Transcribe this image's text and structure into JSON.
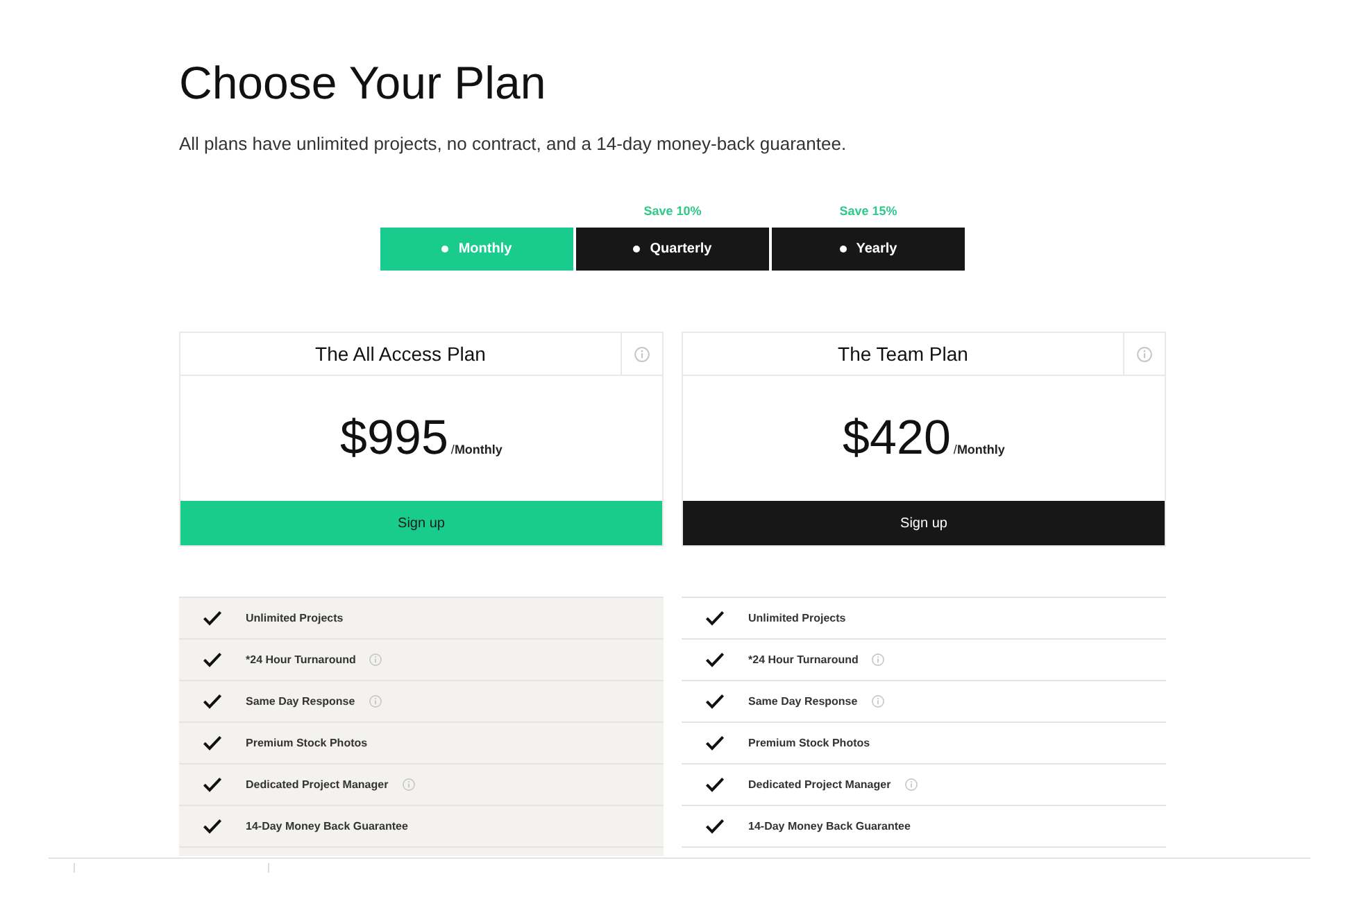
{
  "header": {
    "title": "Choose Your Plan",
    "subtitle": "All plans have unlimited projects, no contract, and a 14-day money-back guarantee."
  },
  "billing_tabs": [
    {
      "label": "Monthly",
      "selected": true
    },
    {
      "label": "Quarterly",
      "selected": false,
      "badge": "Save 10%"
    },
    {
      "label": "Yearly",
      "selected": false,
      "badge": "Save 15%"
    }
  ],
  "plans": [
    {
      "name": "The All Access Plan",
      "price": "$995",
      "period": "/**Monthly**",
      "button": "Sign up",
      "highlighted": true,
      "features": [
        {
          "label": "Unlimited Projects",
          "info": false
        },
        {
          "label": "*24 Hour Turnaround",
          "info": true
        },
        {
          "label": "Same Day Response",
          "info": true
        },
        {
          "label": "Premium Stock Photos",
          "info": false
        },
        {
          "label": "Dedicated Project Manager",
          "info": true
        },
        {
          "label": "14-Day Money Back Guarantee",
          "info": false
        }
      ]
    },
    {
      "name": "The Team Plan",
      "price": "$420",
      "period": "/**Monthly**",
      "button": "Sign up",
      "highlighted": false,
      "features": [
        {
          "label": "Unlimited Projects",
          "info": false
        },
        {
          "label": "*24 Hour Turnaround",
          "info": true
        },
        {
          "label": "Same Day Response",
          "info": true
        },
        {
          "label": "Premium Stock Photos",
          "info": false
        },
        {
          "label": "Dedicated Project Manager",
          "info": true
        },
        {
          "label": "14-Day Money Back Guarantee",
          "info": false
        }
      ]
    }
  ]
}
